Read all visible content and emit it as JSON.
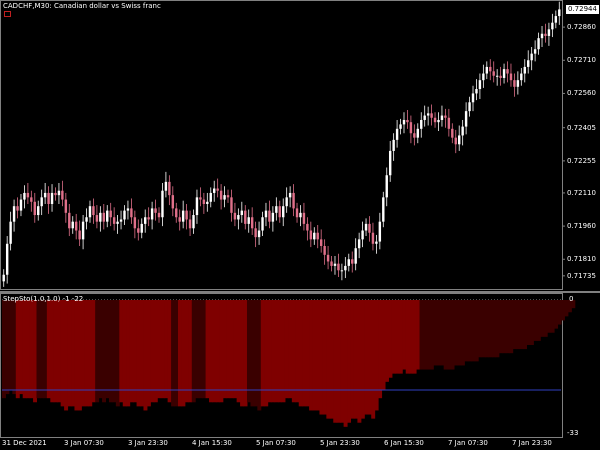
{
  "chart_header": {
    "symbol_label": "CADCHF,M30:  Canadian dollar vs Swiss franc",
    "current_price": "0.72944"
  },
  "indicator_header": {
    "label": "StepSto(1.0,1.0) -1 -22"
  },
  "price_axis": {
    "ticks": [
      "0.72860",
      "0.72710",
      "0.72560",
      "0.72405",
      "0.72255",
      "0.72110",
      "0.71960",
      "0.71810",
      "0.71735"
    ]
  },
  "indicator_axis": {
    "top": "0",
    "bottom": "-33"
  },
  "time_axis": {
    "ticks": [
      "31 Dec 2021",
      "3 Jan 07:30",
      "3 Jan 23:30",
      "4 Jan 15:30",
      "5 Jan 07:30",
      "5 Jan 23:30",
      "6 Jan 15:30",
      "7 Jan 07:30",
      "7 Jan 23:30"
    ]
  },
  "colors": {
    "background": "#000000",
    "bull_candle": "#ffffff",
    "bear_candle": "#e0708a",
    "indicator_bright": "#7f0000",
    "indicator_dark": "#3a0000",
    "level_line": "#3040c0",
    "grid": "#808080"
  },
  "chart_data": {
    "type": "candlestick",
    "price_ylim": [
      0.7168,
      0.7296
    ],
    "indicator_ylim": [
      -33,
      0
    ],
    "indicator_level": -22,
    "price_close_series": [
      0.7174,
      0.7188,
      0.7198,
      0.7205,
      0.7203,
      0.7208,
      0.7211,
      0.7209,
      0.7207,
      0.7201,
      0.7205,
      0.7209,
      0.7211,
      0.7206,
      0.7211,
      0.721,
      0.7212,
      0.7208,
      0.7202,
      0.7195,
      0.7198,
      0.7194,
      0.719,
      0.7198,
      0.72,
      0.7205,
      0.7201,
      0.7198,
      0.7202,
      0.7198,
      0.7203,
      0.72,
      0.7197,
      0.7198,
      0.7199,
      0.7203,
      0.7204,
      0.72,
      0.7195,
      0.7193,
      0.7197,
      0.72,
      0.7199,
      0.7204,
      0.7202,
      0.72,
      0.7212,
      0.7216,
      0.721,
      0.7204,
      0.72,
      0.7198,
      0.7203,
      0.7199,
      0.7195,
      0.7201,
      0.7209,
      0.7208,
      0.7206,
      0.7207,
      0.7211,
      0.7213,
      0.7212,
      0.7208,
      0.721,
      0.7209,
      0.7202,
      0.7199,
      0.7201,
      0.7203,
      0.7197,
      0.72,
      0.7195,
      0.7191,
      0.7194,
      0.72,
      0.7203,
      0.7198,
      0.7202,
      0.7205,
      0.72,
      0.7205,
      0.7209,
      0.7211,
      0.7204,
      0.72,
      0.7202,
      0.7197,
      0.7194,
      0.719,
      0.7193,
      0.719,
      0.7187,
      0.7183,
      0.718,
      0.7178,
      0.7179,
      0.7176,
      0.7176,
      0.7178,
      0.7181,
      0.7179,
      0.7186,
      0.719,
      0.7194,
      0.7197,
      0.7193,
      0.7188,
      0.7189,
      0.7198,
      0.7209,
      0.7219,
      0.723,
      0.7235,
      0.724,
      0.7242,
      0.7244,
      0.7243,
      0.7238,
      0.7236,
      0.724,
      0.7244,
      0.7246,
      0.7247,
      0.7245,
      0.7243,
      0.7244,
      0.7246,
      0.7245,
      0.724,
      0.7236,
      0.7233,
      0.7237,
      0.7241,
      0.7248,
      0.7252,
      0.7256,
      0.7258,
      0.7262,
      0.7265,
      0.7268,
      0.7266,
      0.7264,
      0.7264,
      0.7263,
      0.7267,
      0.7265,
      0.7262,
      0.7259,
      0.7262,
      0.7265,
      0.7268,
      0.7271,
      0.7274,
      0.7276,
      0.7281,
      0.7283,
      0.7282,
      0.7285,
      0.7288,
      0.7291,
      0.7294
    ],
    "indicator_low_series": [
      -24,
      -23,
      -22,
      -23,
      -24,
      -23,
      -24,
      -24,
      -24,
      -25,
      -24,
      -24,
      -24,
      -24,
      -25,
      -25,
      -25,
      -26,
      -27,
      -26,
      -26,
      -27,
      -27,
      -26,
      -26,
      -26,
      -25,
      -25,
      -24,
      -25,
      -24,
      -25,
      -25,
      -26,
      -25,
      -26,
      -26,
      -25,
      -25,
      -26,
      -26,
      -27,
      -26,
      -25,
      -25,
      -24,
      -24,
      -24,
      -25,
      -26,
      -26,
      -26,
      -26,
      -25,
      -25,
      -25,
      -24,
      -24,
      -24,
      -24,
      -25,
      -25,
      -25,
      -25,
      -24,
      -24,
      -24,
      -24,
      -25,
      -26,
      -26,
      -25,
      -26,
      -26,
      -27,
      -26,
      -26,
      -25,
      -25,
      -25,
      -25,
      -25,
      -24,
      -24,
      -25,
      -25,
      -26,
      -26,
      -26,
      -27,
      -27,
      -27,
      -28,
      -28,
      -29,
      -29,
      -30,
      -30,
      -30,
      -31,
      -30,
      -29,
      -29,
      -30,
      -29,
      -28,
      -28,
      -29,
      -27,
      -24,
      -22,
      -20,
      -19,
      -18,
      -18,
      -18,
      -17,
      -18,
      -18,
      -18,
      -17,
      -17,
      -17,
      -17,
      -17,
      -16,
      -16,
      -16,
      -17,
      -17,
      -17,
      -16,
      -16,
      -16,
      -15,
      -15,
      -15,
      -15,
      -14,
      -14,
      -14,
      -14,
      -14,
      -14,
      -13,
      -13,
      -13,
      -13,
      -12,
      -12,
      -12,
      -12,
      -11,
      -11,
      -10,
      -10,
      -9,
      -9,
      -8,
      -8,
      -7,
      -6,
      -5,
      -4,
      -3,
      -2
    ]
  }
}
